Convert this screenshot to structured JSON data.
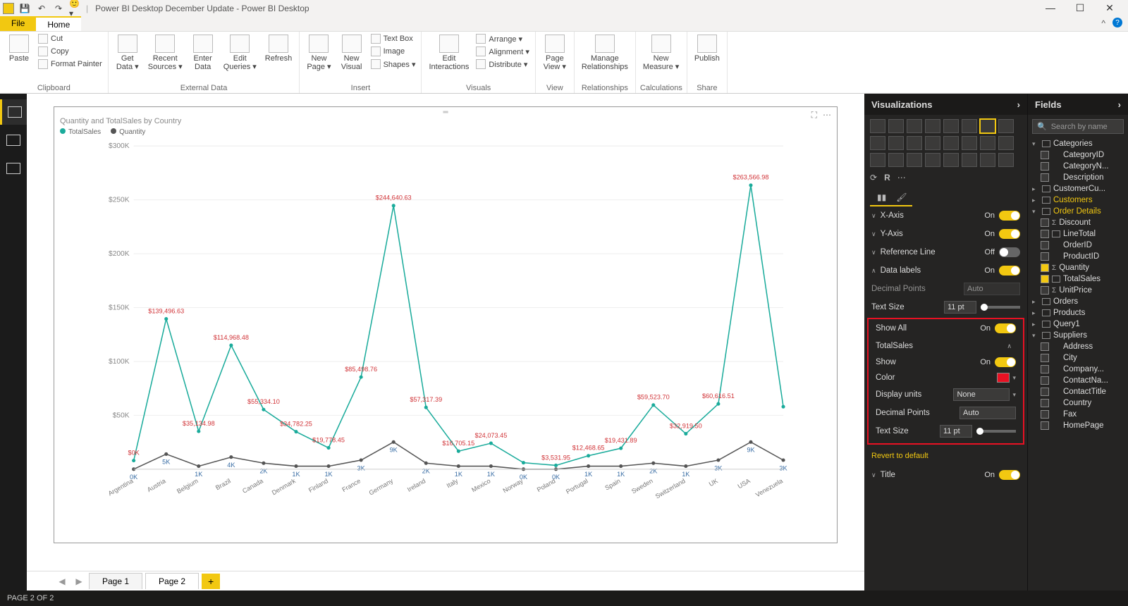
{
  "title": "Power BI Desktop December Update - Power BI Desktop",
  "menus": {
    "file": "File",
    "home": "Home"
  },
  "ribbon": {
    "clipboard": {
      "label": "Clipboard",
      "paste": "Paste",
      "cut": "Cut",
      "copy": "Copy",
      "format_painter": "Format Painter"
    },
    "external": {
      "label": "External Data",
      "get_data": "Get\nData ▾",
      "recent_sources": "Recent\nSources ▾",
      "enter_data": "Enter\nData",
      "edit_queries": "Edit\nQueries ▾",
      "refresh": "Refresh"
    },
    "insert": {
      "label": "Insert",
      "new_page": "New\nPage ▾",
      "new_visual": "New\nVisual",
      "text_box": "Text Box",
      "image": "Image",
      "shapes": "Shapes ▾"
    },
    "visuals": {
      "label": "Visuals",
      "edit_interactions": "Edit\nInteractions",
      "arrange": "Arrange ▾",
      "alignment": "Alignment ▾",
      "distribute": "Distribute ▾"
    },
    "view": {
      "label": "View",
      "page_view": "Page\nView ▾"
    },
    "relationships": {
      "label": "Relationships",
      "manage": "Manage\nRelationships"
    },
    "calculations": {
      "label": "Calculations",
      "new_measure": "New\nMeasure ▾"
    },
    "share": {
      "label": "Share",
      "publish": "Publish"
    }
  },
  "chart_data": {
    "type": "line",
    "title": "Quantity and TotalSales by Country",
    "legend": [
      "TotalSales",
      "Quantity"
    ],
    "ylabel": "",
    "y_ticks": [
      "$50K",
      "$100K",
      "$150K",
      "$200K",
      "$250K",
      "$300K"
    ],
    "ylim": [
      0,
      300000
    ],
    "categories": [
      "Argentina",
      "Austria",
      "Belgium",
      "Brazil",
      "Canada",
      "Denmark",
      "Finland",
      "France",
      "Germany",
      "Ireland",
      "Italy",
      "Mexico",
      "Norway",
      "Poland",
      "Portugal",
      "Spain",
      "Sweden",
      "Switzerland",
      "UK",
      "USA",
      "Venezuela"
    ],
    "series": [
      {
        "name": "TotalSales",
        "values": [
          8000,
          139496.63,
          35134.98,
          114968.48,
          55334.1,
          34782.25,
          19778.45,
          85498.76,
          244640.63,
          57317.39,
          16705.15,
          24073.45,
          6000,
          3531.95,
          12468.65,
          19431.89,
          59523.7,
          32919.5,
          60616.51,
          263566.98,
          58000
        ],
        "labels": [
          "$0K",
          "$139,496.63",
          "$35,134.98",
          "$114,968.48",
          "$55,334.10",
          "$34,782.25",
          "$19,778.45",
          "$85,498.76",
          "$244,640.63",
          "$57,317.39",
          "$16,705.15",
          "$24,073.45",
          "",
          "$3,531.95",
          "$12,468.65",
          "$19,431.89",
          "$59,523.70",
          "$32,919.50",
          "$60,616.51",
          "$263,566.98",
          ""
        ],
        "color": "#1aab9b"
      },
      {
        "name": "Quantity",
        "values": [
          0,
          5,
          1,
          4,
          2,
          1,
          1,
          3,
          9,
          2,
          1,
          1,
          0,
          0,
          1,
          1,
          2,
          1,
          3,
          9,
          3
        ],
        "labels": [
          "0K",
          "5K",
          "1K",
          "4K",
          "2K",
          "1K",
          "1K",
          "3K",
          "9K",
          "2K",
          "1K",
          "1K",
          "0K",
          "0K",
          "1K",
          "1K",
          "2K",
          "1K",
          "3K",
          "9K",
          "3K"
        ],
        "color": "#555"
      }
    ]
  },
  "pages": {
    "p1": "Page 1",
    "p2": "Page 2"
  },
  "status": "PAGE 2 OF 2",
  "viz_panel": {
    "title": "Visualizations",
    "xaxis": "X-Axis",
    "xaxis_state": "On",
    "yaxis": "Y-Axis",
    "yaxis_state": "On",
    "refline": "Reference Line",
    "refline_state": "Off",
    "datalabels": "Data labels",
    "datalabels_state": "On",
    "decimal_points_cut": "Decimal Points",
    "decimal_points_cut_val": "Auto",
    "text_size": "Text Size",
    "text_size_val": "11 pt",
    "show_all": "Show All",
    "show_all_state": "On",
    "section": "TotalSales",
    "show": "Show",
    "show_state": "On",
    "color": "Color",
    "color_val": "#e81123",
    "display_units": "Display units",
    "display_units_val": "None",
    "decimal_points": "Decimal Points",
    "decimal_points_val": "Auto",
    "text_size2": "Text Size",
    "text_size2_val": "11 pt",
    "revert": "Revert to default",
    "title_row": "Title",
    "title_row_state": "On"
  },
  "fields_panel": {
    "title": "Fields",
    "search_placeholder": "Search by name",
    "tables": [
      {
        "name": "Categories",
        "expanded": true,
        "hl": false,
        "fields": [
          {
            "name": "CategoryID"
          },
          {
            "name": "CategoryN..."
          },
          {
            "name": "Description"
          }
        ]
      },
      {
        "name": "CustomerCu...",
        "expanded": false
      },
      {
        "name": "Customers",
        "expanded": false,
        "hl": true
      },
      {
        "name": "Order Details",
        "expanded": true,
        "hl": true,
        "fields": [
          {
            "name": "Discount",
            "sigma": true
          },
          {
            "name": "LineTotal",
            "icon": "fx"
          },
          {
            "name": "OrderID"
          },
          {
            "name": "ProductID"
          },
          {
            "name": "Quantity",
            "checked": true,
            "sigma": true
          },
          {
            "name": "TotalSales",
            "checked": true,
            "icon": "calc"
          },
          {
            "name": "UnitPrice",
            "sigma": true
          }
        ]
      },
      {
        "name": "Orders",
        "expanded": false
      },
      {
        "name": "Products",
        "expanded": false
      },
      {
        "name": "Query1",
        "expanded": false
      },
      {
        "name": "Suppliers",
        "expanded": true,
        "fields": [
          {
            "name": "Address"
          },
          {
            "name": "City"
          },
          {
            "name": "Company..."
          },
          {
            "name": "ContactNa..."
          },
          {
            "name": "ContactTitle"
          },
          {
            "name": "Country"
          },
          {
            "name": "Fax"
          },
          {
            "name": "HomePage"
          }
        ]
      }
    ]
  }
}
